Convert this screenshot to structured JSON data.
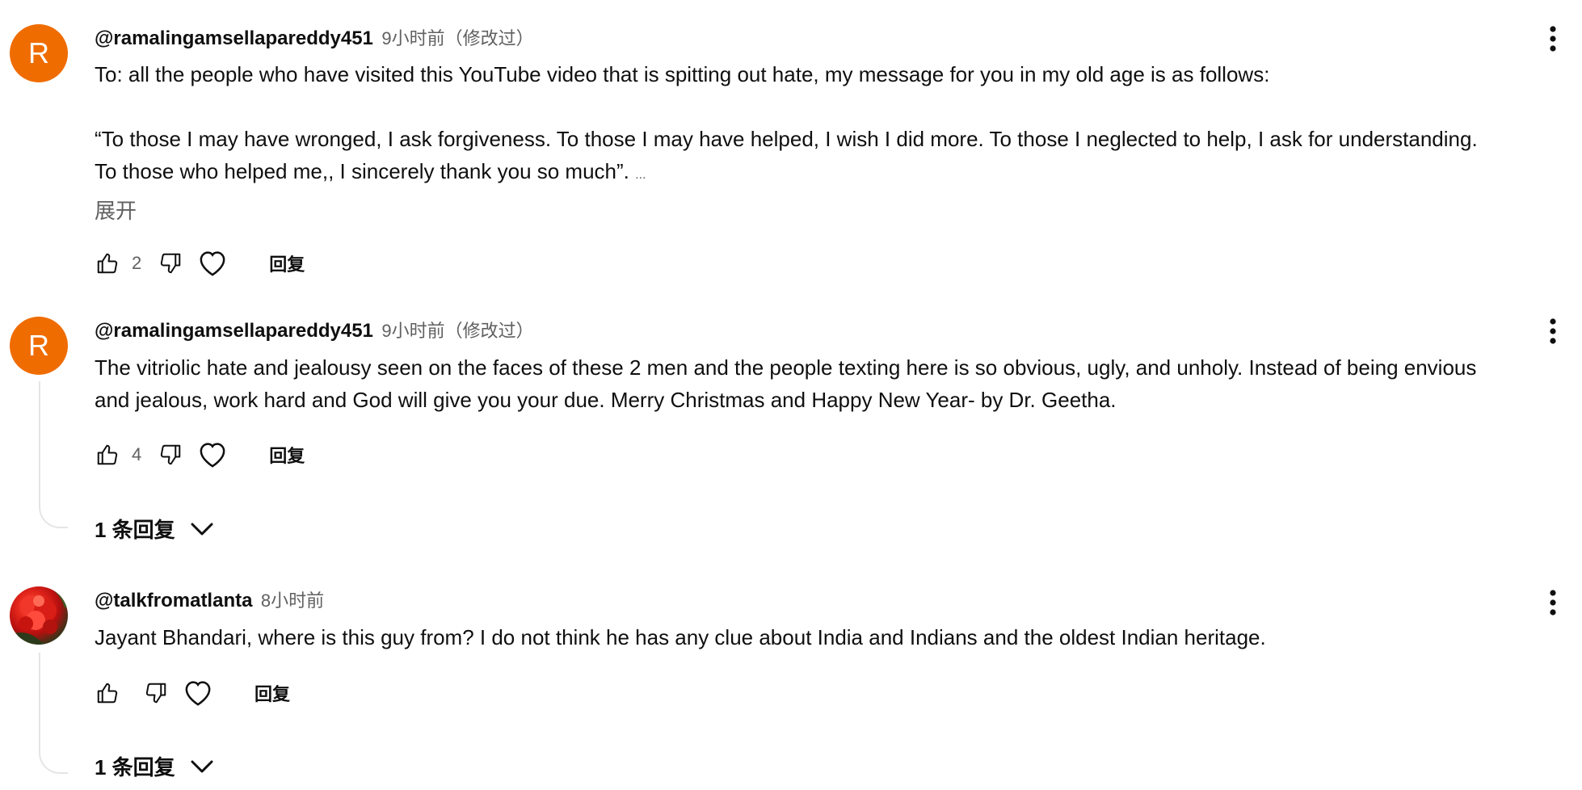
{
  "comments": [
    {
      "avatar_letter": "R",
      "author": "@ramalingamsellapareddy451",
      "time": "9小时前（修改过）",
      "lines": [
        "To: all the people who have visited this YouTube video that is spitting out hate, my message for you in my old age is as follows:",
        "“To those I may have wronged, I ask forgiveness. To those I may have helped, I wish I did more. To those I neglected to help, I ask for understanding.",
        "To those who helped me,, I sincerely thank you so much”. "
      ],
      "ellipsis": "...",
      "expand_label": "展开",
      "likes": "2",
      "reply_label": "回复",
      "avatar_color": "#ef6c00"
    },
    {
      "avatar_letter": "R",
      "author": "@ramalingamsellapareddy451",
      "time": "9小时前（修改过）",
      "lines": [
        "The vitriolic hate and jealousy seen on the faces of these 2 men and the people texting here is so obvious, ugly, and unholy. Instead of being envious",
        "and jealous, work hard and God will give you your due. Merry Christmas and Happy New Year- by Dr. Geetha."
      ],
      "likes": "4",
      "reply_label": "回复",
      "replies_label": "1 条回复",
      "avatar_color": "#ef6c00"
    },
    {
      "author": "@talkfromatlanta",
      "time": "8小时前",
      "lines": [
        "Jayant Bhandari, where is this guy from? I do not think he has any clue about India and Indians and the oldest Indian heritage."
      ],
      "reply_label": "回复",
      "replies_label": "1 条回复"
    }
  ],
  "icons": {
    "like": "thumb-up-icon",
    "dislike": "thumb-down-icon",
    "heart": "heart-icon",
    "menu": "more-vert-icon",
    "expand_replies": "chevron-down-icon"
  }
}
